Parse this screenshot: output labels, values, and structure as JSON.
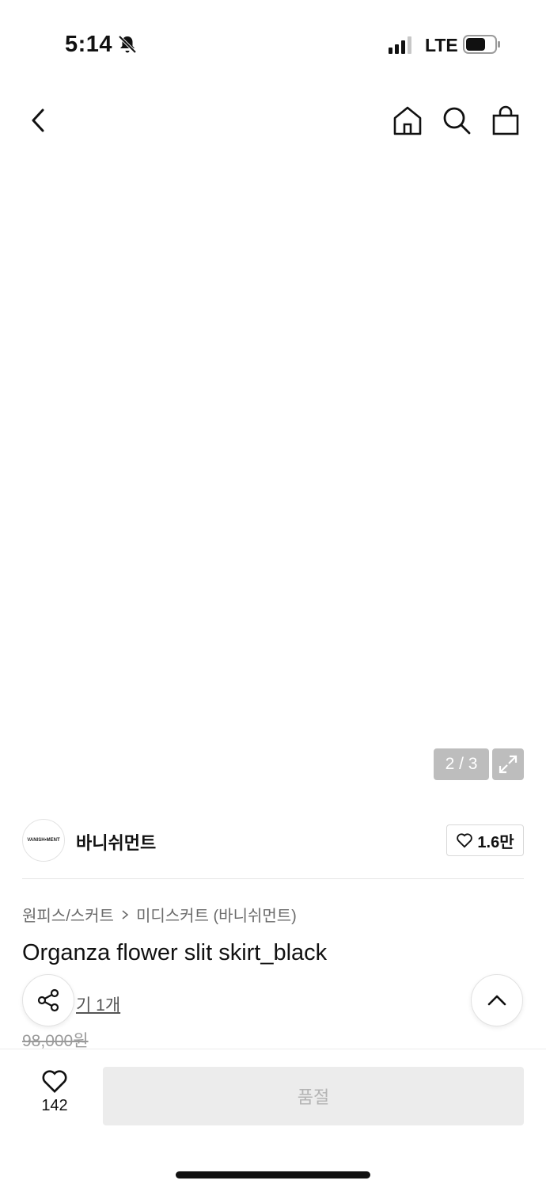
{
  "status_bar": {
    "time": "5:14",
    "network": "LTE"
  },
  "header": {
    "back_icon": "chevron-left-icon",
    "home_icon": "home-icon",
    "search_icon": "search-icon",
    "cart_icon": "shopping-bag-icon"
  },
  "gallery": {
    "pager": "2 / 3",
    "expand_icon": "expand-icon"
  },
  "brand": {
    "logo_text": "VANISH•MENT",
    "name": "바니쉬먼트",
    "likes": "1.6만"
  },
  "product": {
    "breadcrumb": [
      "원피스/스커트",
      "미디스커트 (바니쉬먼트)"
    ],
    "title": "Organza flower slit skirt_black",
    "review_link": "기 1개",
    "original_price": "98,000원"
  },
  "bottom_bar": {
    "wish_count": "142",
    "soldout_label": "품절"
  }
}
